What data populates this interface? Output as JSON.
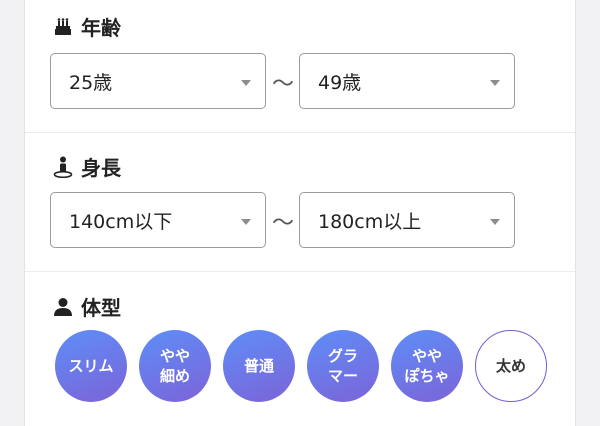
{
  "age": {
    "title": "年齢",
    "icon": "cake-icon",
    "min_value": "25歳",
    "separator": "〜",
    "max_value": "49歳"
  },
  "height": {
    "title": "身長",
    "icon": "person-height-icon",
    "min_value": "140cm以下",
    "separator": "〜",
    "max_value": "180cm以上"
  },
  "body_type": {
    "title": "体型",
    "icon": "user-icon",
    "options": [
      {
        "label": "スリム",
        "selected": true
      },
      {
        "label": "やや\n細め",
        "selected": true
      },
      {
        "label": "普通",
        "selected": true
      },
      {
        "label": "グラ\nマー",
        "selected": true
      },
      {
        "label": "やや\nぽちゃ",
        "selected": true
      },
      {
        "label": "太め",
        "selected": false
      }
    ]
  },
  "colors": {
    "chip_gradient_start": "#5e8ef7",
    "chip_gradient_end": "#7c63d8",
    "unselected_border": "#6e5fd6"
  }
}
